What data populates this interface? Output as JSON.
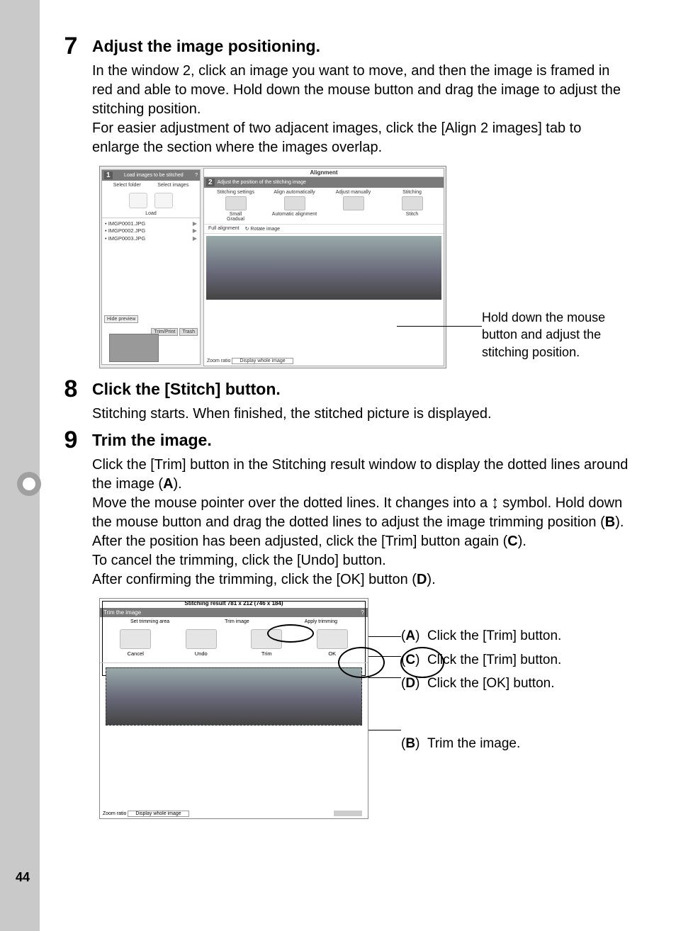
{
  "page_number": "44",
  "steps": {
    "s7": {
      "num": "7",
      "heading": "Adjust the image positioning.",
      "body1": "In the window 2, click an image you want to move, and then the image is framed in red and able to move. Hold down the mouse button and drag the image to adjust the stitching position.",
      "body2": "For easier adjustment of two adjacent images, click the [Align 2 images] tab to enlarge the section where the images overlap."
    },
    "s8": {
      "num": "8",
      "heading": "Click the [Stitch] button.",
      "body1": "Stitching starts. When finished, the stitched picture is displayed."
    },
    "s9": {
      "num": "9",
      "heading": "Trim the image.",
      "body1": "Click the [Trim] button in the Stitching result window to display the dotted lines around the image (",
      "body1b": ").",
      "body2a": "Move the mouse pointer over the dotted lines. It changes into a ",
      "body2b": " symbol. Hold down the mouse button and drag the dotted lines to adjust the image trimming position (",
      "body2c": ").",
      "body3a": "After the position has been adjusted, click the [Trim] button again (",
      "body3b": ").",
      "body4": "To cancel the trimming, click the [Undo] button.",
      "body5a": "After confirming the trimming, click the [OK] button (",
      "body5b": ")."
    }
  },
  "bold": {
    "A": "A",
    "B": "B",
    "C": "C",
    "D": "D"
  },
  "caption1": "Hold down the mouse button and adjust the stitching position.",
  "screenshot1": {
    "panel1_title": "Load images to be stitched",
    "panel1_num": "1",
    "sel_folder": "Select folder",
    "sel_images": "Select images",
    "load": "Load",
    "files": [
      "IMGP0001.JPG",
      "IMGP0002.JPG",
      "IMGP0003.JPG"
    ],
    "trim_print": "Trim/Print",
    "trash": "Trash",
    "hide_preview": "Hide preview",
    "align_title": "Alignment",
    "panel2_num": "2",
    "panel2_title": "Adjust the position of the stitching image",
    "col1": "Stitching settings",
    "col1a": "Small",
    "col1b": "Gradual",
    "col2": "Align automatically",
    "col2a": "Automatic alignment",
    "col3": "Adjust manually",
    "col4": "Stitching",
    "col4a": "Stitch",
    "full_alignment": "Full alignment",
    "rotate": "Rotate image",
    "zoom_label": "Zoom ratio",
    "zoom_val": "Display whole image"
  },
  "screenshot2": {
    "title": "Stitching result 781 x 212 (746 x 184)",
    "header": "Trim the image",
    "set_trim": "Set trimming area",
    "trim_image": "Trim image",
    "apply": "Apply trimming",
    "cancel": "Cancel",
    "undo": "Undo",
    "trim": "Trim",
    "ok": "OK",
    "zoom_label": "Zoom ratio",
    "zoom_val": "Display whole image"
  },
  "annots": {
    "A": "Click the [Trim] button.",
    "C": "Click the [Trim] button.",
    "D": "Click the [OK] button.",
    "B": "Trim the image."
  }
}
